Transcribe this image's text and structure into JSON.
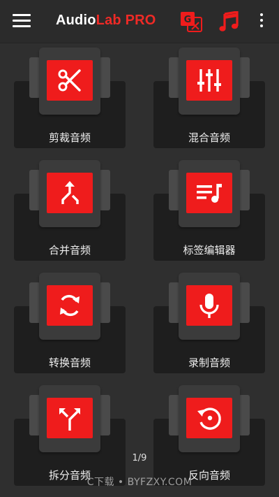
{
  "appbar": {
    "title_part1": "Audio",
    "title_part2": "Lab PRO",
    "menu_icon": "hamburger-menu-icon",
    "translate_icon": "translate-icon",
    "music_icon": "music-note-icon",
    "more_icon": "more-vert-icon"
  },
  "colors": {
    "accent": "#ef1c1c",
    "background": "#2f2f2f",
    "card": "#1e1e1e"
  },
  "tools": [
    {
      "label": "剪裁音频",
      "icon": "scissors-icon"
    },
    {
      "label": "混合音频",
      "icon": "mixer-sliders-icon"
    },
    {
      "label": "合并音频",
      "icon": "merge-arrows-icon"
    },
    {
      "label": "标签编辑器",
      "icon": "playlist-music-icon"
    },
    {
      "label": "转换音频",
      "icon": "convert-sync-icon"
    },
    {
      "label": "录制音频",
      "icon": "microphone-icon"
    },
    {
      "label": "拆分音频",
      "icon": "split-arrows-icon"
    },
    {
      "label": "反向音频",
      "icon": "reverse-replay-icon"
    }
  ],
  "pager": "1/9",
  "watermark": "C下载 • BYFZXY.COM"
}
